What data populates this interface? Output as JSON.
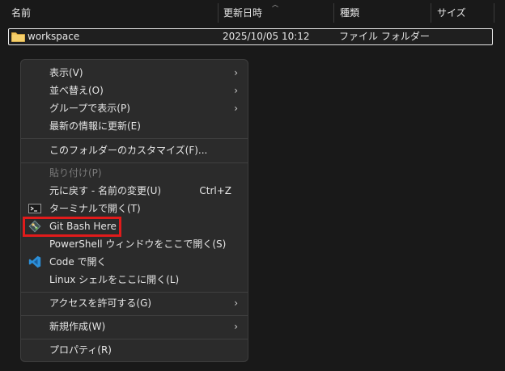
{
  "columns": {
    "name": "名前",
    "date": "更新日時",
    "type": "種類",
    "size": "サイズ"
  },
  "row": {
    "name": "workspace",
    "date": "2025/10/05 10:12",
    "type": "ファイル フォルダー"
  },
  "menu": {
    "view": "表示(V)",
    "sort": "並べ替え(O)",
    "group": "グループで表示(P)",
    "refresh": "最新の情報に更新(E)",
    "customize": "このフォルダーのカスタマイズ(F)...",
    "paste": "貼り付け(P)",
    "undo": "元に戻す - 名前の変更(U)",
    "undo_shortcut": "Ctrl+Z",
    "terminal": "ターミナルで開く(T)",
    "gitbash": "Git Bash Here",
    "powershell": "PowerShell ウィンドウをここで開く(S)",
    "vscode": "Code で開く",
    "linux": "Linux シェルをここに開く(L)",
    "access": "アクセスを許可する(G)",
    "new": "新規作成(W)",
    "properties": "プロパティ(R)"
  },
  "colors": {
    "highlight": "#e11b1b",
    "folder": "#f2c55c",
    "vscode": "#2c8fd8"
  },
  "icons": {
    "terminal": "terminal-icon",
    "gitbash": "git-bash-icon",
    "vscode": "vscode-icon",
    "folder": "folder-icon",
    "submenu": "chevron-right-icon"
  }
}
